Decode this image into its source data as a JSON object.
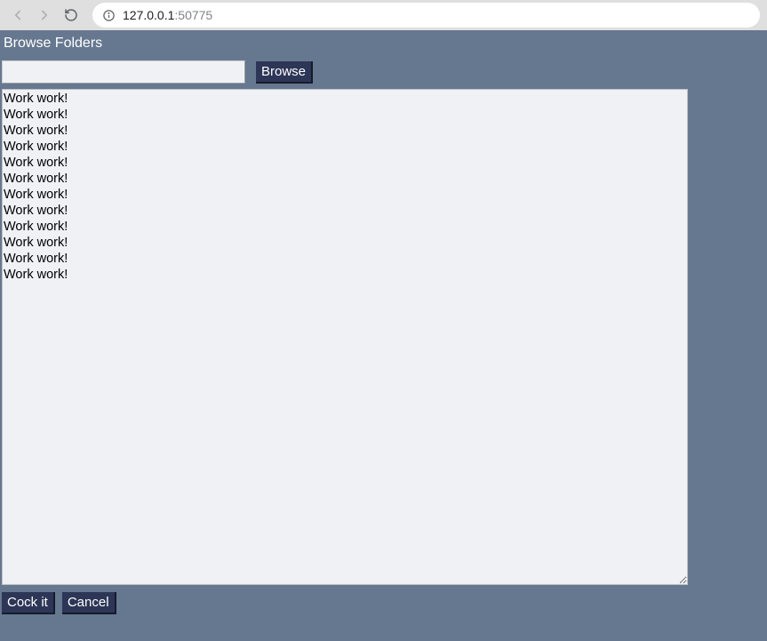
{
  "browser": {
    "url_host": "127.0.0.1",
    "url_port": ":50775"
  },
  "app": {
    "heading": "Browse Folders",
    "path_input_value": "",
    "browse_button_label": "Browse",
    "textarea_value": "Work work!\nWork work!\nWork work!\nWork work!\nWork work!\nWork work!\nWork work!\nWork work!\nWork work!\nWork work!\nWork work!\nWork work!",
    "cock_it_label": "Cock it",
    "cancel_label": "Cancel"
  }
}
